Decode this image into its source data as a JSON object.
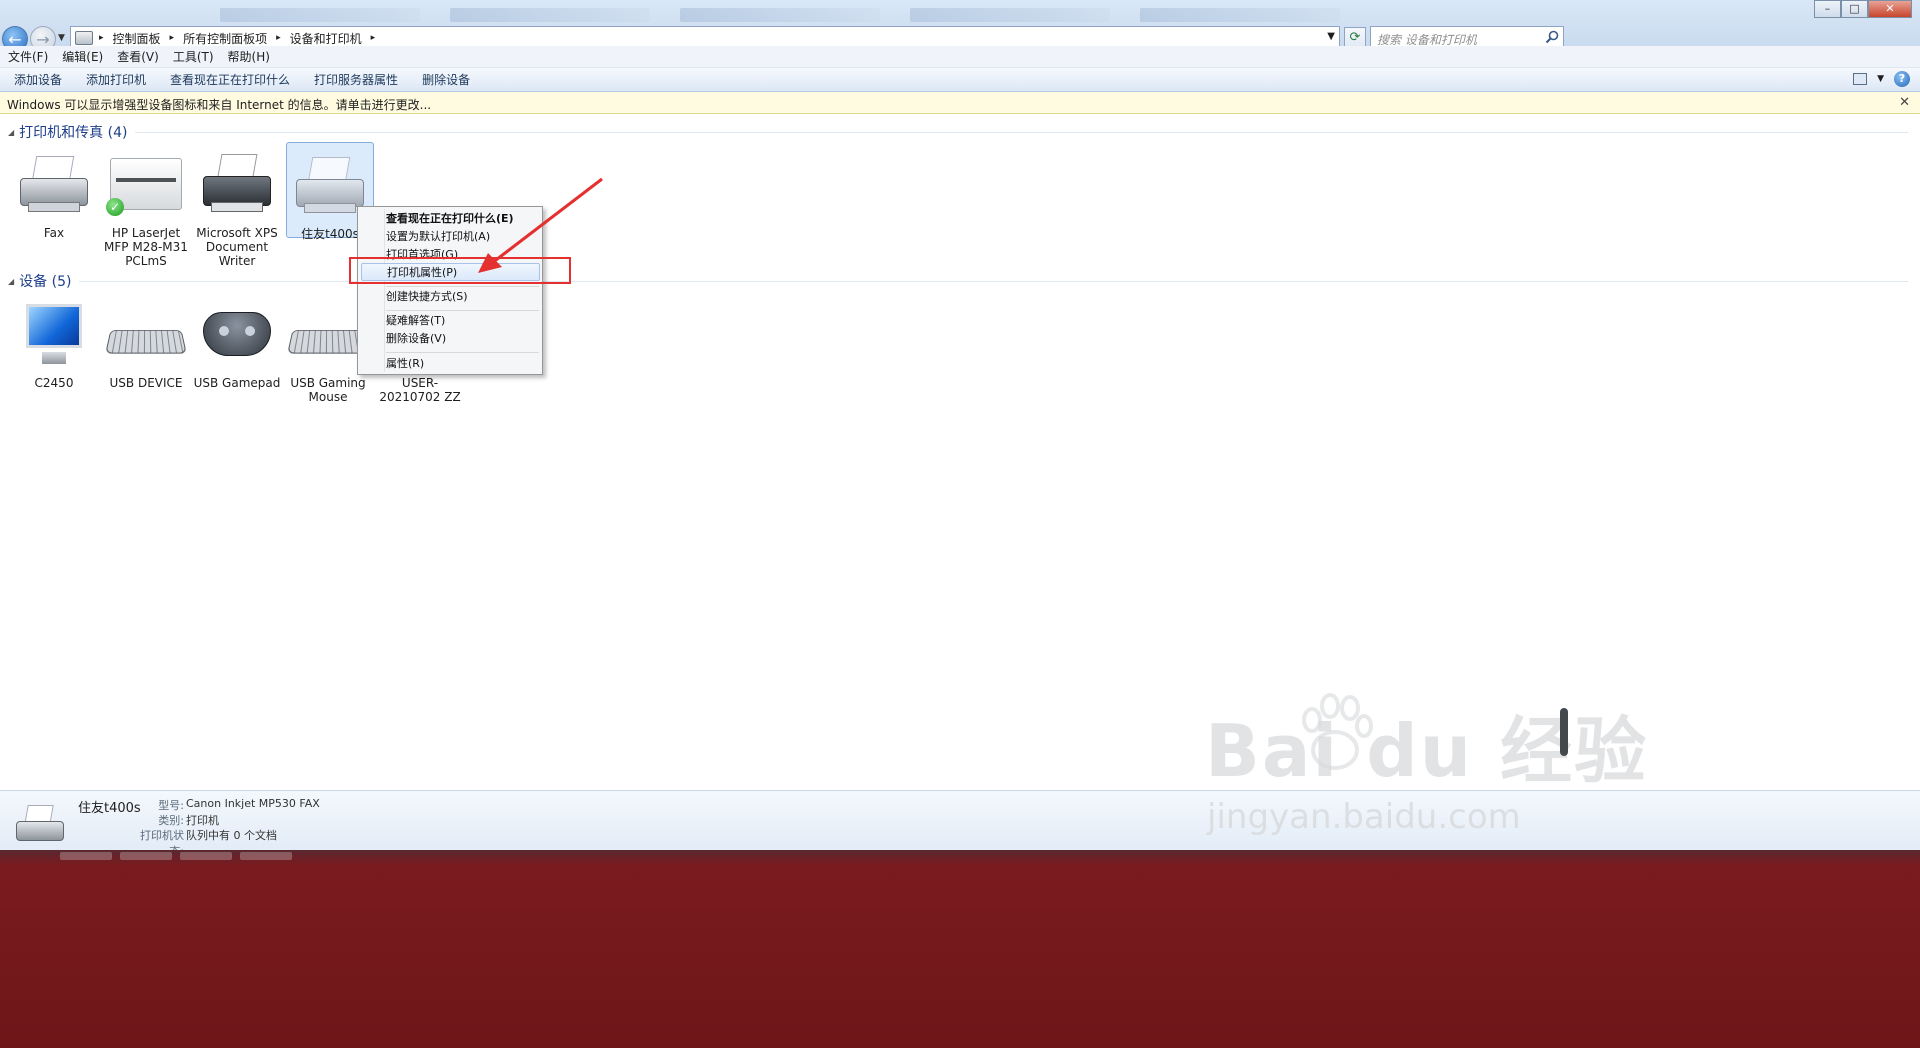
{
  "window": {
    "back_label": "←",
    "forward_label": "→",
    "minimize": "–",
    "maximize": "□",
    "close": "✕"
  },
  "address": {
    "crumbs": [
      "控制面板",
      "所有控制面板项",
      "设备和打印机"
    ],
    "separator": "▸"
  },
  "search": {
    "placeholder": "搜索 设备和打印机"
  },
  "menu": [
    "文件(F)",
    "编辑(E)",
    "查看(V)",
    "工具(T)",
    "帮助(H)"
  ],
  "commands": [
    "添加设备",
    "添加打印机",
    "查看现在正在打印什么",
    "打印服务器属性",
    "删除设备"
  ],
  "help_label": "?",
  "infobar": {
    "text": "Windows 可以显示增强型设备图标和来自 Internet 的信息。请单击进行更改...",
    "close": "✕"
  },
  "groups": {
    "printers": {
      "title": "打印机和传真 (4)",
      "items": [
        {
          "label": "Fax"
        },
        {
          "label": "HP LaserJet MFP M28-M31 PCLmS"
        },
        {
          "label": "Microsoft XPS Document Writer"
        },
        {
          "label": "住友t400s"
        }
      ]
    },
    "devices": {
      "title": "设备 (5)",
      "items": [
        {
          "label": "C2450"
        },
        {
          "label": "USB DEVICE"
        },
        {
          "label": "USB Gamepad"
        },
        {
          "label": "USB Gaming Mouse"
        },
        {
          "label": "USER-20210702 ZZ"
        }
      ]
    }
  },
  "context_menu": {
    "items": [
      "查看现在正在打印什么(E)",
      "设置为默认打印机(A)",
      "打印首选项(G)",
      "打印机属性(P)",
      "创建快捷方式(S)",
      "疑难解答(T)",
      "删除设备(V)",
      "属性(R)"
    ],
    "highlighted_index": 3,
    "annotation_color": "#e53030"
  },
  "details": {
    "name": "住友t400s",
    "model_key": "型号:",
    "model": "Canon Inkjet MP530 FAX",
    "category_key": "类别:",
    "category": "打印机",
    "status_key": "打印机状态:",
    "status": "队列中有 0 个文档"
  },
  "watermark": {
    "brand": "Bai du 经验",
    "url": "jingyan.baidu.com"
  }
}
